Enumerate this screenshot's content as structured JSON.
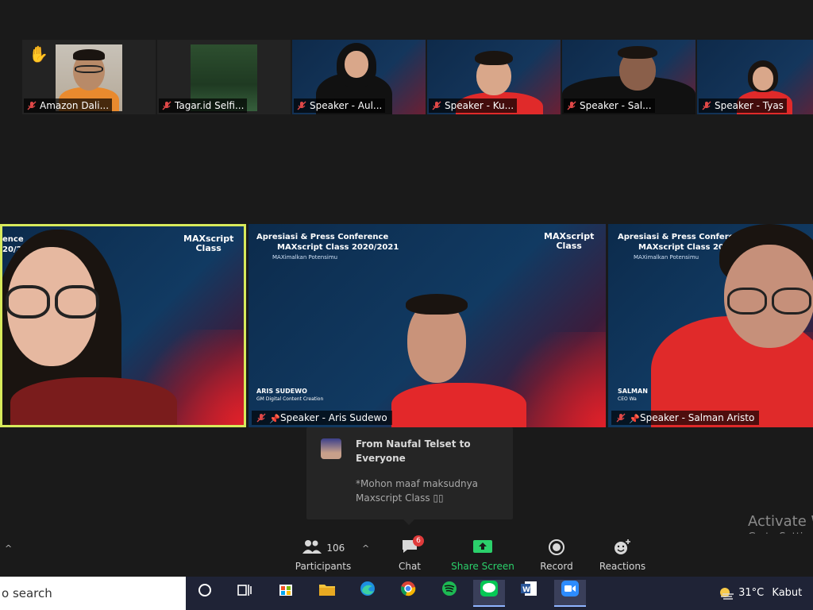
{
  "top_strip": [
    {
      "label": "Amazon Dali...",
      "type": "photo",
      "raised_hand": true
    },
    {
      "label": "Tagar.id Selfi...",
      "type": "forest"
    },
    {
      "label": "Speaker - Aul...",
      "type": "stage"
    },
    {
      "label": "Speaker - Ku...",
      "type": "stage"
    },
    {
      "label": "Speaker - Sal...",
      "type": "stage"
    },
    {
      "label": "Speaker - Tyas",
      "type": "stage"
    }
  ],
  "stage": {
    "headline_1": "Apresiasi & Press Conference",
    "headline_2": "MAXscript Class 2020/2021",
    "tagline": "MAXimalkan Potensimu",
    "logo_1": "MAXscript",
    "logo_2": "Class",
    "headline_1_cut": "ence",
    "headline_2_cut": "20/2"
  },
  "main_tiles": [
    {
      "label": "",
      "active": true
    },
    {
      "label": "Speaker - Aris Sudewo",
      "card_name": "ARIS SUDEWO",
      "card_title": "GM Digital Content Creation"
    },
    {
      "label": "Speaker - Salman Aristo",
      "card_name": "SALMAN",
      "card_title": "CEO Wa"
    }
  ],
  "chat_popup": {
    "from": "From Naufal Telset to Everyone",
    "message": "*Mohon maaf maksudnya Maxscript Class ▯▯"
  },
  "toolbar": {
    "participants_count": "106",
    "participants_label": "Participants",
    "chat_label": "Chat",
    "chat_badge": "6",
    "share_label": "Share Screen",
    "record_label": "Record",
    "reactions_label": "Reactions"
  },
  "activate": {
    "line1": "Activate W",
    "line2": "Go to Settin"
  },
  "taskbar": {
    "search_text": "o search",
    "weather_temp": "31°C",
    "weather_desc": "Kabut"
  }
}
